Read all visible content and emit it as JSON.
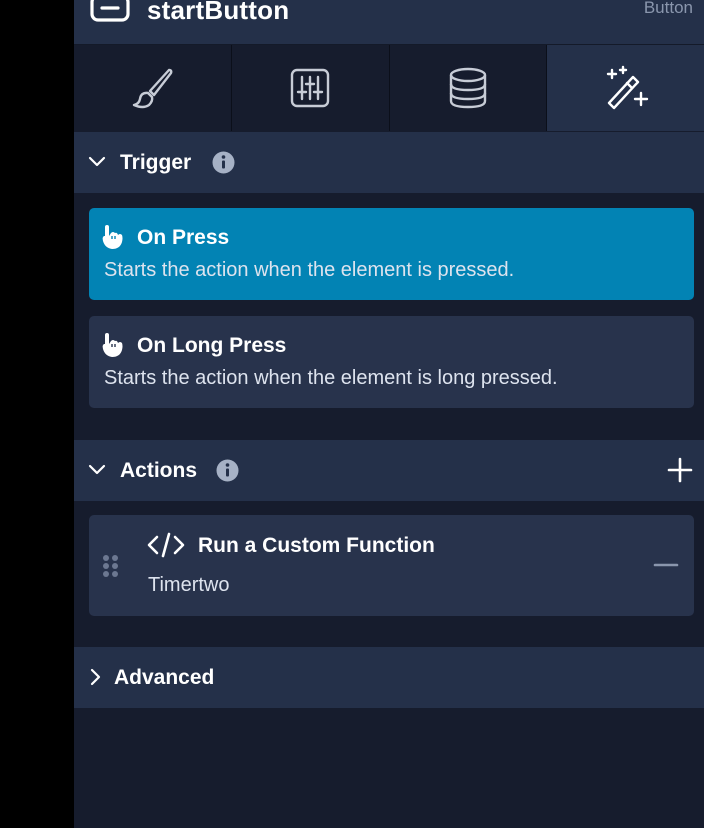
{
  "header": {
    "title": "startButton",
    "type": "Button",
    "icon": "button-element-icon"
  },
  "tabs": [
    {
      "name": "style",
      "icon": "paintbrush-icon",
      "active": false
    },
    {
      "name": "properties",
      "icon": "sliders-icon",
      "active": false
    },
    {
      "name": "data",
      "icon": "database-icon",
      "active": false
    },
    {
      "name": "actions",
      "icon": "magic-wand-icon",
      "active": true
    }
  ],
  "trigger": {
    "title": "Trigger",
    "expanded": true,
    "options": [
      {
        "title": "On Press",
        "description": "Starts the action when the element is pressed.",
        "selected": true,
        "icon": "pointing-hand-icon"
      },
      {
        "title": "On Long Press",
        "description": "Starts the action when the element is long pressed.",
        "selected": false,
        "icon": "pointing-hand-icon"
      }
    ]
  },
  "actions": {
    "title": "Actions",
    "expanded": true,
    "items": [
      {
        "title": "Run a Custom Function",
        "subtitle": "Timertwo",
        "icon": "code-icon"
      }
    ]
  },
  "advanced": {
    "title": "Advanced",
    "expanded": false
  },
  "colors": {
    "panel_bg": "#161c2d",
    "section_bg": "#243049",
    "card_bg": "#28334c",
    "selected_bg": "#0283b4"
  }
}
